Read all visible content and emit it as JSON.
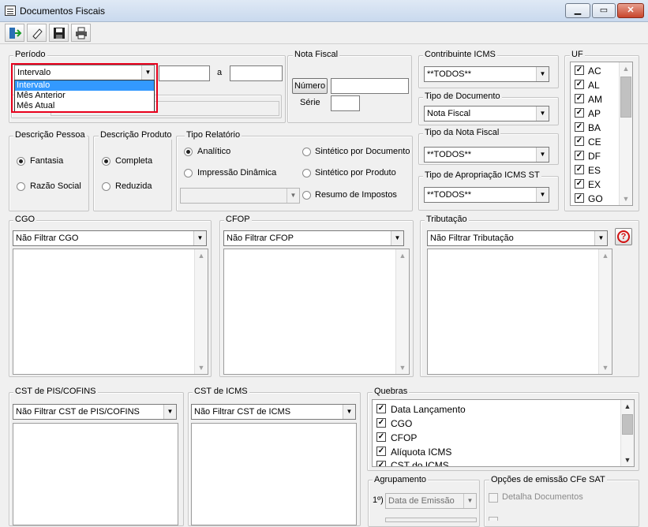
{
  "window": {
    "title": "Documentos Fiscais",
    "minimize": "▁",
    "maximize": "▭",
    "close": "✕"
  },
  "periodo": {
    "legend": "Período",
    "selected": "Intervalo",
    "a_label": "a",
    "options": [
      "Intervalo",
      "Mês Anterior",
      "Mês Atual"
    ]
  },
  "nota_fiscal": {
    "legend": "Nota Fiscal",
    "numero_button": "Número",
    "serie_label": "Série"
  },
  "contribuinte": {
    "legend": "Contribuinte ICMS",
    "selected": "**TODOS**"
  },
  "tipo_documento": {
    "legend": "Tipo de Documento",
    "selected": "Nota Fiscal"
  },
  "tipo_nota": {
    "legend": "Tipo da Nota Fiscal",
    "selected": "**TODOS**"
  },
  "apropriacao": {
    "legend": "Tipo de Apropriação ICMS ST",
    "selected": "**TODOS**"
  },
  "uf": {
    "legend": "UF",
    "items": [
      "AC",
      "AL",
      "AM",
      "AP",
      "BA",
      "CE",
      "DF",
      "ES",
      "EX",
      "GO"
    ]
  },
  "desc_pessoa": {
    "legend": "Descrição Pessoa",
    "opt1": "Fantasia",
    "opt2": "Razão Social"
  },
  "desc_produto": {
    "legend": "Descrição Produto",
    "opt1": "Completa",
    "opt2": "Reduzida"
  },
  "tipo_relatorio": {
    "legend": "Tipo Relatório",
    "analitico": "Analítico",
    "impressao": "Impressão Dinâmica",
    "sint_doc": "Sintético por Documento",
    "sint_prod": "Sintético por Produto",
    "resumo": "Resumo de Impostos"
  },
  "cgo": {
    "legend": "CGO",
    "selected": "Não Filtrar CGO"
  },
  "cfop": {
    "legend": "CFOP",
    "selected": "Não Filtrar CFOP"
  },
  "tributacao": {
    "legend": "Tributação",
    "selected": "Não Filtrar Tributação",
    "help": "?"
  },
  "cst_pis": {
    "legend": "CST de PIS/COFINS",
    "selected": "Não Filtrar CST de PIS/COFINS"
  },
  "cst_icms": {
    "legend": "CST de ICMS",
    "selected": "Não Filtrar CST de ICMS"
  },
  "quebras": {
    "legend": "Quebras",
    "items": [
      "Data Lançamento",
      "CGO",
      "CFOP",
      "Alíquota ICMS",
      "CST do ICMS"
    ]
  },
  "agrupamento": {
    "legend": "Agrupamento",
    "prefix": "1º)",
    "selected": "Data de Emissão"
  },
  "cfe_sat": {
    "legend": "Opções de emissão CFe SAT",
    "detalha": "Detalha Documentos"
  }
}
